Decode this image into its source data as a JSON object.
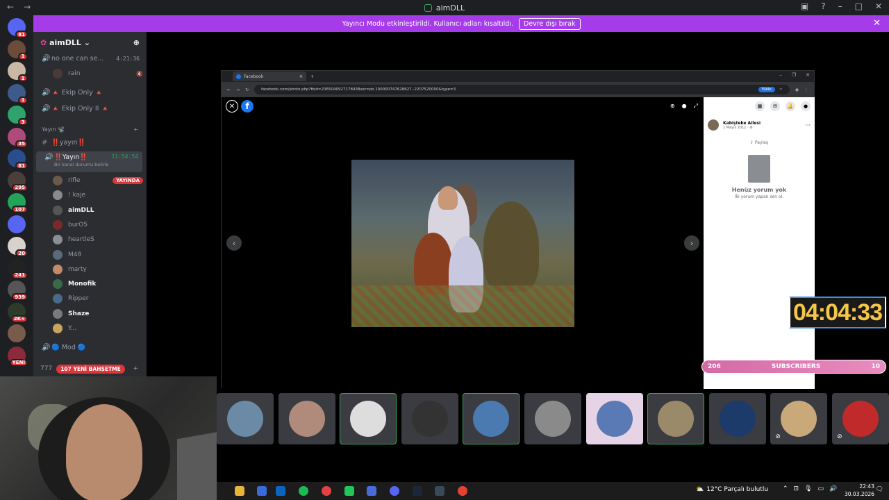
{
  "window": {
    "title": "aimDLL",
    "nav_back": "←",
    "nav_fwd": "→"
  },
  "notice": {
    "text": "Yayıncı Modu etkinleştirildi. Kullanıcı adları kısaltıldı.",
    "button": "Devre dışı bırak",
    "close": "✕"
  },
  "guilds": [
    {
      "badge": "81",
      "color": "#5865f2"
    },
    {
      "badge": "1",
      "color": "#6b4b3a"
    },
    {
      "badge": "1",
      "color": "#c9b8a5"
    },
    {
      "badge": "1",
      "color": "#3e5a8a"
    },
    {
      "badge": "3",
      "color": "#2fa36b"
    },
    {
      "badge": "35",
      "color": "#b04a7a"
    },
    {
      "badge": "81",
      "color": "#2a4d8f"
    },
    {
      "badge": "295",
      "color": "#4a3f3a"
    },
    {
      "badge": "107",
      "color": "#23a559"
    },
    {
      "badge": "",
      "color": "#5865f2"
    },
    {
      "badge": "20",
      "color": "#d9d2cc"
    },
    {
      "badge": "241",
      "color": "#222"
    },
    {
      "badge": "939",
      "color": "#555"
    },
    {
      "badge": "2K+",
      "color": "#2e3b2a"
    },
    {
      "badge": "",
      "color": "#7a5a4a"
    },
    {
      "badge": "YENİ",
      "color": "#8a2a3a"
    }
  ],
  "server": {
    "name": "aimDLL"
  },
  "channels": {
    "top_voice": {
      "name": "no one can se...",
      "time": "4:21:36"
    },
    "top_user": "rain",
    "ekip1": "🔺 Ekip Only 🔺",
    "ekip2": "🔺 Ekip Only II 🔺",
    "category": "Yayın 📽️",
    "text_channel": "‼️yayın‼️",
    "live_voice": {
      "name": "‼️Yayın‼️",
      "time": "11:54:54",
      "status": "Bir kanal durumu belirle"
    },
    "users": [
      {
        "name": "rifle",
        "live": "YAYINDA",
        "color": "#6a5a4a"
      },
      {
        "name": "! kaje",
        "color": "#8a8a8a"
      },
      {
        "name": "aimDLL",
        "color": "#555",
        "bold": true
      },
      {
        "name": "burO5",
        "color": "#7a2a2a"
      },
      {
        "name": "heartleS",
        "color": "#8a8f95"
      },
      {
        "name": "M48",
        "color": "#5a6a7a"
      },
      {
        "name": "marty",
        "color": "#c28a6a"
      },
      {
        "name": "Monofik",
        "color": "#3a6a4a",
        "bold": true
      },
      {
        "name": "Ripper",
        "color": "#4a6a8a"
      },
      {
        "name": "Shaze",
        "color": "#7a7a7a",
        "bold": true
      },
      {
        "name": "Y...",
        "color": "#caa35a"
      }
    ],
    "mod": "🔵 Mod 🔵",
    "bottom_num": "777",
    "bottom_pill": "107 YENİ BAHSETME"
  },
  "browser": {
    "tab": "Facebook",
    "url": "facebook.com/photo.php?fbid=2065040927178438set=pb.100000747628627.-2207520000&type=3",
    "upload": "Yükle",
    "poster": "Kabiştеke Ailesi",
    "date": "1 Mayıs 2011 · ⚙",
    "share": "⇪ Paylaş",
    "no_comments": "Henüz yorum yok",
    "no_comments_sub": "İlk yorum yapan sen ol."
  },
  "overlay": {
    "timer": "04:04:33",
    "subs_left": "206",
    "subs_label": "SUBSCRIBERS",
    "subs_right": "10"
  },
  "tiles": [
    {
      "color": "#6a8aa5",
      "speaking": false
    },
    {
      "color": "#b08a7a",
      "speaking": false
    },
    {
      "color": "#ddd",
      "speaking": true
    },
    {
      "color": "#333",
      "speaking": false
    },
    {
      "color": "#4a7ab0",
      "speaking": true
    },
    {
      "color": "#8a8a8a",
      "speaking": false
    },
    {
      "color": "#5a7ab5",
      "speaking": false,
      "bg": "#e6d4e6"
    },
    {
      "color": "#9a8a6a",
      "speaking": true
    },
    {
      "color": "#1c3a6a",
      "speaking": false
    },
    {
      "color": "#c9a87a",
      "speaking": false,
      "muted": true
    },
    {
      "color": "#c02a2a",
      "speaking": false,
      "muted": true
    }
  ],
  "taskbar": {
    "weather": "12°C  Parçalı bulutlu",
    "time": "22:43",
    "date": "30.03.2026"
  }
}
